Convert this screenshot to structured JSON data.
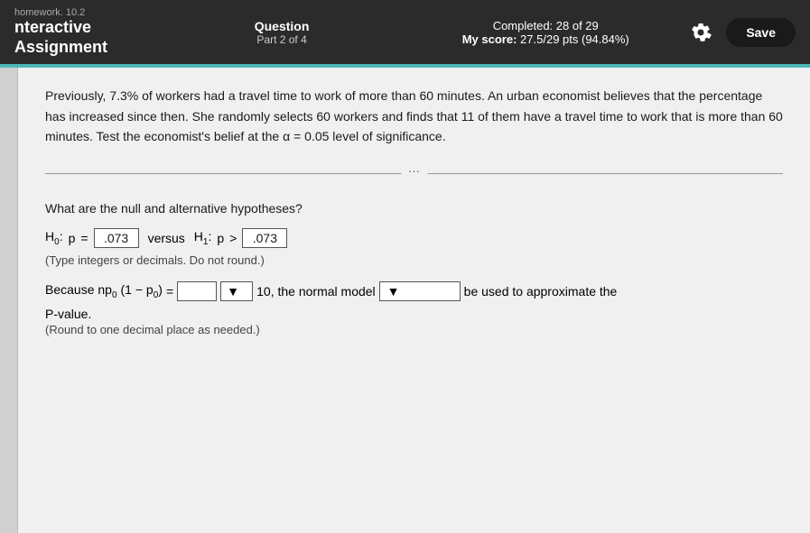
{
  "header": {
    "subtitle": "homework. 10.2",
    "title_line1": "nteractive",
    "title_line2": "Assignment",
    "question_label": "Question",
    "part_label": "Part 2 of 4",
    "completed_label": "Completed: 28 of 29",
    "score_label": "My score:",
    "score_value": "27.5/29 pts (94.84%)",
    "save_label": "Save"
  },
  "problem": {
    "text": "Previously, 7.3% of workers had a travel time to work of more than 60 minutes. An urban economist believes that the percentage has increased since then. She randomly selects 60 workers and finds that 11 of them have a travel time to work that is more than 60 minutes. Test the economist's belief at the α = 0.05 level of significance."
  },
  "question": {
    "label": "What are the null and alternative hypotheses?",
    "h0_prefix": "H",
    "h0_sub": "0",
    "h0_var": "p",
    "h0_operator": "=",
    "h0_value": ".073",
    "versus_label": "versus",
    "h1_prefix": "H",
    "h1_sub": "1",
    "h1_var": "p",
    "h1_operator": ">",
    "h1_value": ".073",
    "hint": "(Type integers or decimals. Do not round.)",
    "normal_model_prefix": "Because np",
    "normal_model_sub": "0",
    "normal_model_paren": "(1 − p",
    "normal_model_paren_sub": "0",
    "normal_model_paren_close": ")",
    "normal_model_eq": "=",
    "normal_model_input": "",
    "normal_model_dropdown1": "▼",
    "normal_model_threshold": "10, the normal model",
    "normal_model_dropdown2": "▼",
    "normal_model_suffix": "be used to approximate the",
    "p_value_label": "P-value.",
    "round_hint": "(Round to one decimal place as needed.)",
    "ellipsis": "···"
  }
}
